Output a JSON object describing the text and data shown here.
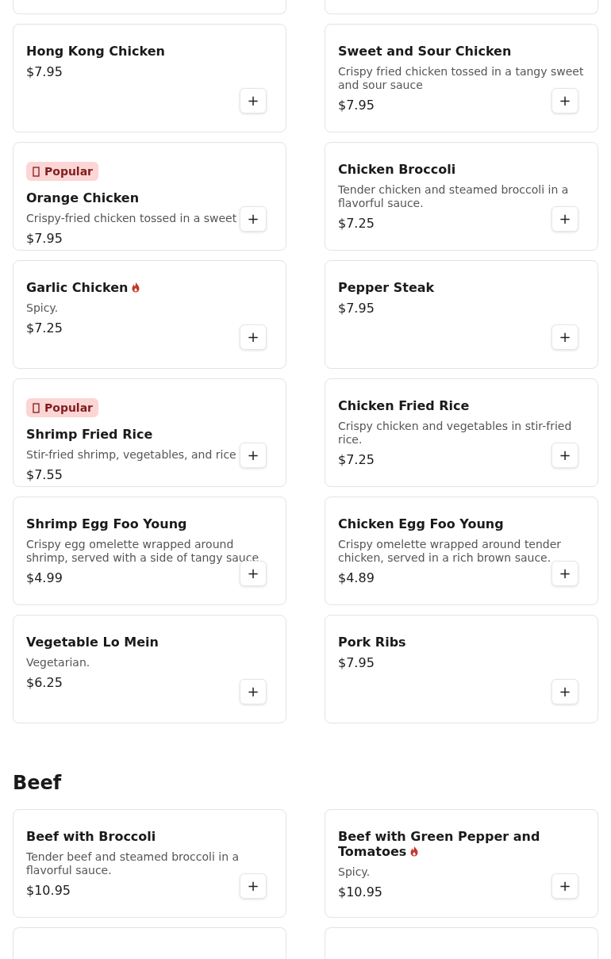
{
  "sections": [
    {
      "items": [
        {
          "name": "Hong Kong Chicken",
          "price": "$7.95",
          "add_label": "+"
        },
        {
          "name": "Sweet and Sour Chicken",
          "description": "Crispy fried chicken tossed in a tangy sweet and sour sauce",
          "price": "$7.95",
          "add_label": "+"
        },
        {
          "badge": "Popular",
          "name": "Orange Chicken",
          "description": "Crispy-fried chicken tossed in a sweet",
          "price": "$7.95",
          "add_label": "+"
        },
        {
          "name": "Chicken Broccoli",
          "description": "Tender chicken and steamed broccoli in a flavorful sauce.",
          "price": "$7.25",
          "add_label": "+"
        },
        {
          "name": "Garlic Chicken",
          "spicy": true,
          "description": "Spicy.",
          "price": "$7.25",
          "add_label": "+"
        },
        {
          "name": "Pepper Steak",
          "price": "$7.95",
          "add_label": "+"
        },
        {
          "badge": "Popular",
          "name": "Shrimp Fried Rice",
          "description": "Stir-fried shrimp, vegetables, and rice",
          "price": "$7.55",
          "add_label": "+"
        },
        {
          "name": "Chicken Fried Rice",
          "description": "Crispy chicken and vegetables in stir-fried rice.",
          "price": "$7.25",
          "add_label": "+"
        },
        {
          "name": "Shrimp Egg Foo Young",
          "description": "Crispy egg omelette wrapped around shrimp, served with a side of tangy sauce",
          "price": "$4.99",
          "add_label": "+"
        },
        {
          "name": "Chicken Egg Foo Young",
          "description": "Crispy omelette wrapped around tender chicken, served in a rich brown sauce.",
          "price": "$4.89",
          "add_label": "+"
        },
        {
          "name": "Vegetable Lo Mein",
          "description": "Vegetarian.",
          "price": "$6.25",
          "add_label": "+"
        },
        {
          "name": "Pork Ribs",
          "price": "$7.95",
          "add_label": "+"
        }
      ]
    },
    {
      "title": "Beef",
      "items": [
        {
          "name": "Beef with Broccoli",
          "description": "Tender beef and steamed broccoli in a flavorful sauce.",
          "price": "$10.95",
          "add_label": "+"
        },
        {
          "name": "Beef with Green Pepper and Tomatoes",
          "spicy": true,
          "description": "Spicy.",
          "price": "$10.95",
          "add_label": "+"
        }
      ]
    }
  ]
}
